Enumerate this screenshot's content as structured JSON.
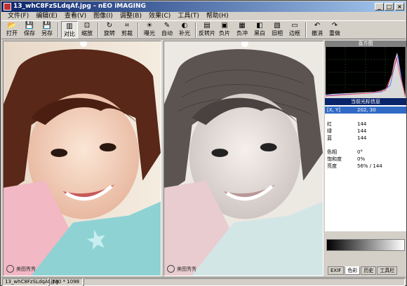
{
  "window": {
    "title": "13_whC8FzSLdqAf.jpg - nEO iMAGING"
  },
  "menu": [
    "文件(F)",
    "编辑(E)",
    "查看(V)",
    "图像(I)",
    "调整(B)",
    "效果(C)",
    "工具(T)",
    "帮助(H)"
  ],
  "toolbar": [
    {
      "label": "打开",
      "icon": "open-folder-icon",
      "glyph": "📂"
    },
    {
      "label": "保存",
      "icon": "save-icon",
      "glyph": "💾"
    },
    {
      "label": "另存",
      "icon": "save-as-icon",
      "glyph": "💾"
    },
    {
      "label": "对比",
      "icon": "compare-icon",
      "glyph": "▥"
    },
    {
      "label": "缩放",
      "icon": "zoom-icon",
      "glyph": "⊡"
    },
    {
      "label": "旋转",
      "icon": "rotate-icon",
      "glyph": "↻"
    },
    {
      "label": "剪裁",
      "icon": "crop-icon",
      "glyph": "⌗"
    },
    {
      "label": "曝光",
      "icon": "exposure-icon",
      "glyph": "☀"
    },
    {
      "label": "自动",
      "icon": "auto-icon",
      "glyph": "✎"
    },
    {
      "label": "补光",
      "icon": "fill-light-icon",
      "glyph": "◐"
    },
    {
      "label": "反转片",
      "icon": "reversal-film-icon",
      "glyph": "▤"
    },
    {
      "label": "负片",
      "icon": "negative-icon",
      "glyph": "▣"
    },
    {
      "label": "负冲",
      "icon": "cross-process-icon",
      "glyph": "▦"
    },
    {
      "label": "黑白",
      "icon": "black-white-icon",
      "glyph": "◧"
    },
    {
      "label": "旧相",
      "icon": "old-photo-icon",
      "glyph": "▧"
    },
    {
      "label": "边框",
      "icon": "frame-icon",
      "glyph": "▭"
    },
    {
      "label": "撤消",
      "icon": "undo-icon",
      "glyph": "↶"
    },
    {
      "label": "重做",
      "icon": "redo-icon",
      "glyph": "↷"
    }
  ],
  "toolbar_selected": "对比",
  "panel": {
    "histogram_title": "直方图",
    "info_title": "当前光标信息",
    "rows": [
      {
        "k": "[X, Y]",
        "v": "202, 30",
        "highlight": true
      },
      {
        "k": "",
        "v": ""
      },
      {
        "k": "红",
        "v": "144"
      },
      {
        "k": "绿",
        "v": "144"
      },
      {
        "k": "蓝",
        "v": "144"
      },
      {
        "k": "",
        "v": ""
      },
      {
        "k": "色相",
        "v": "0°"
      },
      {
        "k": "饱和度",
        "v": "0%"
      },
      {
        "k": "亮度",
        "v": "56% / 144"
      }
    ],
    "tabs": [
      "EXIF",
      "色彩",
      "历史",
      "工具栏"
    ],
    "active_tab": "色彩"
  },
  "watermark": "美图秀秀",
  "status": {
    "file": "13_whC8FzSLdqAf.jpg",
    "size": "730 * 1098"
  }
}
